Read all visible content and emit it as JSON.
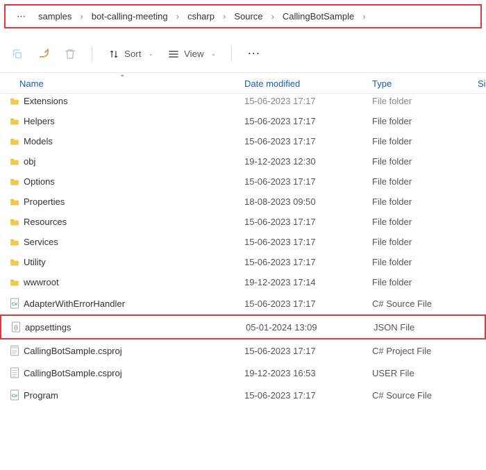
{
  "breadcrumb": {
    "items": [
      "samples",
      "bot-calling-meeting",
      "csharp",
      "Source",
      "CallingBotSample"
    ]
  },
  "toolbar": {
    "sort_label": "Sort",
    "view_label": "View"
  },
  "columns": {
    "name": "Name",
    "date": "Date modified",
    "type": "Type",
    "size": "Si"
  },
  "files": [
    {
      "icon": "folder",
      "name": "Extensions",
      "date": "15-06-2023 17:17",
      "type": "File folder",
      "highlight": false,
      "clipped": true
    },
    {
      "icon": "folder",
      "name": "Helpers",
      "date": "15-06-2023 17:17",
      "type": "File folder",
      "highlight": false
    },
    {
      "icon": "folder",
      "name": "Models",
      "date": "15-06-2023 17:17",
      "type": "File folder",
      "highlight": false
    },
    {
      "icon": "folder",
      "name": "obj",
      "date": "19-12-2023 12:30",
      "type": "File folder",
      "highlight": false
    },
    {
      "icon": "folder",
      "name": "Options",
      "date": "15-06-2023 17:17",
      "type": "File folder",
      "highlight": false
    },
    {
      "icon": "folder",
      "name": "Properties",
      "date": "18-08-2023 09:50",
      "type": "File folder",
      "highlight": false
    },
    {
      "icon": "folder",
      "name": "Resources",
      "date": "15-06-2023 17:17",
      "type": "File folder",
      "highlight": false
    },
    {
      "icon": "folder",
      "name": "Services",
      "date": "15-06-2023 17:17",
      "type": "File folder",
      "highlight": false
    },
    {
      "icon": "folder",
      "name": "Utility",
      "date": "15-06-2023 17:17",
      "type": "File folder",
      "highlight": false
    },
    {
      "icon": "folder",
      "name": "wwwroot",
      "date": "19-12-2023 17:14",
      "type": "File folder",
      "highlight": false
    },
    {
      "icon": "csharp",
      "name": "AdapterWithErrorHandler",
      "date": "15-06-2023 17:17",
      "type": "C# Source File",
      "highlight": false
    },
    {
      "icon": "json",
      "name": "appsettings",
      "date": "05-01-2024 13:09",
      "type": "JSON File",
      "highlight": true
    },
    {
      "icon": "csproj",
      "name": "CallingBotSample.csproj",
      "date": "15-06-2023 17:17",
      "type": "C# Project File",
      "highlight": false
    },
    {
      "icon": "doc",
      "name": "CallingBotSample.csproj",
      "date": "19-12-2023 16:53",
      "type": "USER File",
      "highlight": false
    },
    {
      "icon": "csharp",
      "name": "Program",
      "date": "15-06-2023 17:17",
      "type": "C# Source File",
      "highlight": false
    }
  ]
}
